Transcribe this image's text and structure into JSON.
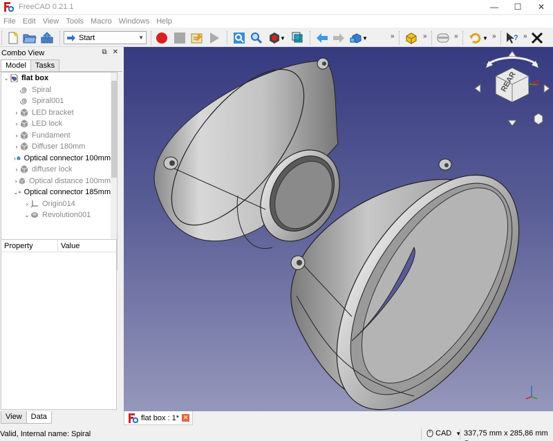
{
  "window": {
    "title": "FreeCAD 0.21.1",
    "controls": [
      "—",
      "☐",
      "✕"
    ]
  },
  "menu": [
    "File",
    "Edit",
    "View",
    "Tools",
    "Macro",
    "Windows",
    "Help"
  ],
  "toolbar": {
    "workbench": "Start",
    "overflow": "»"
  },
  "combo": {
    "title": "Combo View",
    "tabs": [
      "Model",
      "Tasks"
    ],
    "tree": [
      {
        "label": "flat box",
        "style": "bold",
        "arrow": "⌄",
        "indent": 0
      },
      {
        "label": "Spiral",
        "style": "grey",
        "arrow": "",
        "indent": 1
      },
      {
        "label": "Spiral001",
        "style": "grey",
        "arrow": "",
        "indent": 1
      },
      {
        "label": "LED bracket",
        "style": "grey",
        "arrow": "›",
        "indent": 1
      },
      {
        "label": "LED lock",
        "style": "grey",
        "arrow": "›",
        "indent": 1
      },
      {
        "label": "Fundament",
        "style": "grey",
        "arrow": "›",
        "indent": 1
      },
      {
        "label": "Diffuser 180mm",
        "style": "grey",
        "arrow": "›",
        "indent": 1
      },
      {
        "label": "Optical connector 100mm",
        "style": "normal",
        "arrow": "›",
        "indent": 1
      },
      {
        "label": "diffuser lock",
        "style": "grey",
        "arrow": "›",
        "indent": 1
      },
      {
        "label": "Optical distance 100mm",
        "style": "grey",
        "arrow": "›",
        "indent": 1
      },
      {
        "label": "Optical connector 185mm",
        "style": "normal",
        "arrow": "⌄",
        "indent": 1
      },
      {
        "label": "Origin014",
        "style": "grey",
        "arrow": "›",
        "indent": 2
      },
      {
        "label": "Revolution001",
        "style": "grey",
        "arrow": "⌄",
        "indent": 2
      }
    ],
    "property_headers": [
      "Property",
      "Value"
    ],
    "bottom_tabs": [
      "View",
      "Data"
    ]
  },
  "navcube": {
    "face": "REAR"
  },
  "document_tab": {
    "label": "flat box : 1*"
  },
  "status": {
    "message": "Valid, Internal name: Spiral",
    "nav_style": "CAD",
    "dimensions": "337,75 mm x 285,86 mm"
  },
  "colors": {
    "view_top": "#363a80",
    "view_bottom": "#9597bb",
    "record": "#d92020",
    "accent_blue": "#2a6cc0"
  }
}
